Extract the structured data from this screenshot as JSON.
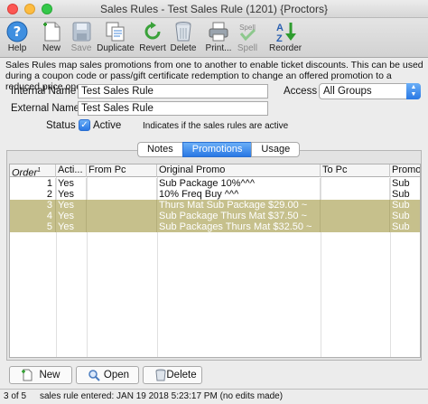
{
  "window": {
    "title": "Sales Rules - Test Sales Rule (1201) {Proctors}"
  },
  "toolbar": {
    "help": "Help",
    "new": "New",
    "save": "Save",
    "duplicate": "Duplicate",
    "revert": "Revert",
    "delete": "Delete",
    "print": "Print...",
    "spell": "Spell",
    "spell_icon_text": "Spell",
    "reorder": "Reorder",
    "reorder_icon_a": "A",
    "reorder_icon_z": "Z"
  },
  "description": "Sales Rules map sales promotions from one to another to enable ticket discounts.  This can be used during a coupon code or pass/gift certificate redemption to change an offered promotion to a reduced price one.",
  "form": {
    "internal_name_label": "Internal Name",
    "internal_name_value": "Test Sales Rule",
    "external_name_label": "External Name",
    "external_name_value": "Test Sales Rule",
    "access_label": "Access",
    "access_value": "All Groups",
    "status_label": "Status",
    "active_label": "Active",
    "active_checked": true,
    "status_hint": "Indicates if the sales rules are active"
  },
  "tabs": [
    {
      "label": "Notes",
      "active": false
    },
    {
      "label": "Promotions",
      "active": true
    },
    {
      "label": "Usage",
      "active": false
    }
  ],
  "table": {
    "columns": [
      "Order",
      "Acti...",
      "From Pc",
      "Original Promo",
      "To Pc",
      "Promot"
    ],
    "order_superscript": "1",
    "rows": [
      {
        "order": "1",
        "active": "Yes",
        "from_pc": "",
        "original_promo": "Sub Package 10%^^^",
        "to_pc": "",
        "promo": "Sub",
        "highlight": false
      },
      {
        "order": "2",
        "active": "Yes",
        "from_pc": "",
        "original_promo": "10% Freq Buy ^^^",
        "to_pc": "",
        "promo": "Sub",
        "highlight": false
      },
      {
        "order": "3",
        "active": "Yes",
        "from_pc": "",
        "original_promo": "Thurs Mat Sub Package $29.00 ~",
        "to_pc": "",
        "promo": "Sub",
        "highlight": true
      },
      {
        "order": "4",
        "active": "Yes",
        "from_pc": "",
        "original_promo": "Sub Package Thurs Mat $37.50 ~",
        "to_pc": "",
        "promo": "Sub",
        "highlight": true
      },
      {
        "order": "5",
        "active": "Yes",
        "from_pc": "",
        "original_promo": "Sub Packages Thurs Mat $32.50 ~",
        "to_pc": "",
        "promo": "Sub",
        "highlight": true
      }
    ]
  },
  "buttons": {
    "new": "New",
    "open": "Open",
    "delete": "Delete"
  },
  "status_bar": {
    "record_position": "3 of 5",
    "info": "sales rule entered: JAN 19 2018 5:23:17 PM (no edits made)"
  },
  "colors": {
    "accent": "#2a78e4",
    "highlight_row": "#c6c08c"
  }
}
